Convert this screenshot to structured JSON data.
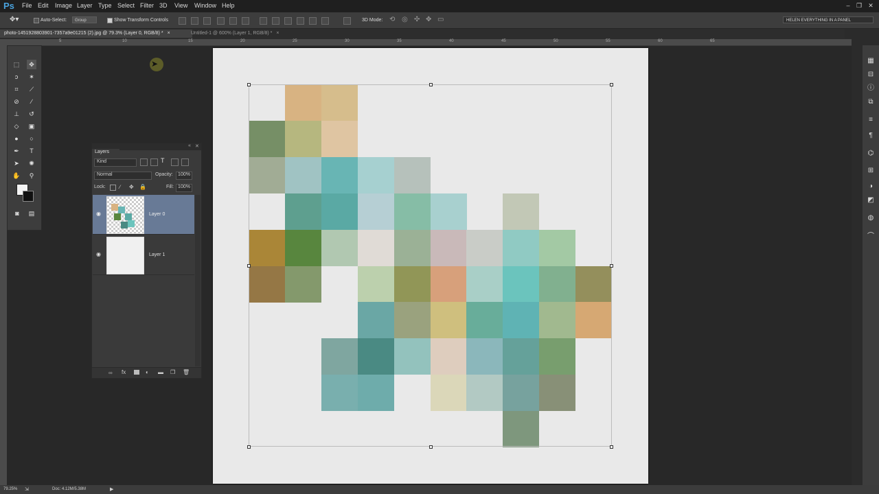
{
  "app": {
    "logo": "Ps"
  },
  "menu": [
    "File",
    "Edit",
    "Image",
    "Layer",
    "Type",
    "Select",
    "Filter",
    "3D",
    "View",
    "Window",
    "Help"
  ],
  "window_controls": {
    "minimize": "–",
    "restore": "❐",
    "close": "✕"
  },
  "options_bar": {
    "tool_icon": "move-tool-icon",
    "auto_select_label": "Auto-Select:",
    "auto_select_value": "Group",
    "transform_controls_label": "Show Transform Controls",
    "mode_3d_label": "3D Mode:",
    "workspace": "HELEN EVERYTHING IN A PANEL"
  },
  "tabs": [
    {
      "label": "photo-1451928803901-7357a9e01215 (2).jpg @ 79.3% (Layer 0, RGB/8) *",
      "close": "×",
      "active": true
    },
    {
      "label": "Untitled-1 @ 600% (Layer 1, RGB/8) *",
      "close": "×",
      "active": false
    }
  ],
  "ruler_labels": [
    "5",
    "10",
    "15",
    "20",
    "25",
    "30",
    "35",
    "40",
    "45",
    "50",
    "55",
    "60",
    "65"
  ],
  "layers_panel": {
    "title": "Layers",
    "filter_kind": "Kind",
    "blend_mode": "Normal",
    "opacity_label": "Opacity:",
    "opacity_value": "100%",
    "lock_label": "Lock:",
    "fill_label": "Fill:",
    "fill_value": "100%",
    "layers": [
      {
        "name": "Layer 0",
        "selected": true
      },
      {
        "name": "Layer 1",
        "selected": false
      }
    ]
  },
  "status_bar": {
    "zoom": "79.25%",
    "doc": "Doc: 4.12M/5.38M"
  },
  "colors": {
    "accent": "#4aa3df",
    "selected_layer": "#687a96"
  },
  "mosaic": {
    "cols": 10,
    "rows": 10,
    "tiles": [
      {
        "c": 1,
        "r": 0,
        "color": "#d8b382"
      },
      {
        "c": 2,
        "r": 0,
        "color": "#d6bd8c"
      },
      {
        "c": 0,
        "r": 1,
        "color": "#768f66"
      },
      {
        "c": 1,
        "r": 1,
        "color": "#b6b77f"
      },
      {
        "c": 2,
        "r": 1,
        "color": "#dfc5a2"
      },
      {
        "c": 0,
        "r": 2,
        "color": "#a1ac95"
      },
      {
        "c": 1,
        "r": 2,
        "color": "#a0c3c3"
      },
      {
        "c": 2,
        "r": 2,
        "color": "#68b5b4"
      },
      {
        "c": 3,
        "r": 2,
        "color": "#a6d0d0"
      },
      {
        "c": 4,
        "r": 2,
        "color": "#b6c1bb"
      },
      {
        "c": 1,
        "r": 3,
        "color": "#5e9f8f"
      },
      {
        "c": 2,
        "r": 3,
        "color": "#5aa9a4"
      },
      {
        "c": 3,
        "r": 3,
        "color": "#b6cfd4"
      },
      {
        "c": 4,
        "r": 3,
        "color": "#86bda6"
      },
      {
        "c": 5,
        "r": 3,
        "color": "#a8d0cf"
      },
      {
        "c": 7,
        "r": 3,
        "color": "#c2c8b6"
      },
      {
        "c": 0,
        "r": 4,
        "color": "#aa8637"
      },
      {
        "c": 1,
        "r": 4,
        "color": "#58863e"
      },
      {
        "c": 2,
        "r": 4,
        "color": "#b1c8b1"
      },
      {
        "c": 3,
        "r": 4,
        "color": "#e0dbd6"
      },
      {
        "c": 4,
        "r": 4,
        "color": "#9bb196"
      },
      {
        "c": 5,
        "r": 4,
        "color": "#c9b9b9"
      },
      {
        "c": 6,
        "r": 4,
        "color": "#c9ccc7"
      },
      {
        "c": 7,
        "r": 4,
        "color": "#90cac3"
      },
      {
        "c": 8,
        "r": 4,
        "color": "#a3c9a4"
      },
      {
        "c": 0,
        "r": 5,
        "color": "#957745"
      },
      {
        "c": 1,
        "r": 5,
        "color": "#84996c"
      },
      {
        "c": 3,
        "r": 5,
        "color": "#bcd0ad"
      },
      {
        "c": 4,
        "r": 5,
        "color": "#919657"
      },
      {
        "c": 5,
        "r": 5,
        "color": "#d7a07b"
      },
      {
        "c": 6,
        "r": 5,
        "color": "#a9cfc7"
      },
      {
        "c": 7,
        "r": 5,
        "color": "#6bc4bd"
      },
      {
        "c": 8,
        "r": 5,
        "color": "#81b08f"
      },
      {
        "c": 9,
        "r": 5,
        "color": "#948f5c"
      },
      {
        "c": 3,
        "r": 6,
        "color": "#6aa7a5"
      },
      {
        "c": 4,
        "r": 6,
        "color": "#9aa27e"
      },
      {
        "c": 5,
        "r": 6,
        "color": "#cfbf7e"
      },
      {
        "c": 6,
        "r": 6,
        "color": "#68ad9a"
      },
      {
        "c": 7,
        "r": 6,
        "color": "#5fb3b4"
      },
      {
        "c": 8,
        "r": 6,
        "color": "#a1b98f"
      },
      {
        "c": 9,
        "r": 6,
        "color": "#d6a873"
      },
      {
        "c": 2,
        "r": 7,
        "color": "#7fa6a0"
      },
      {
        "c": 3,
        "r": 7,
        "color": "#4a8a83"
      },
      {
        "c": 4,
        "r": 7,
        "color": "#93c2bd"
      },
      {
        "c": 5,
        "r": 7,
        "color": "#decdbe"
      },
      {
        "c": 6,
        "r": 7,
        "color": "#8bb7bb"
      },
      {
        "c": 7,
        "r": 7,
        "color": "#65a19a"
      },
      {
        "c": 8,
        "r": 7,
        "color": "#789e6e"
      },
      {
        "c": 2,
        "r": 8,
        "color": "#79afae"
      },
      {
        "c": 3,
        "r": 8,
        "color": "#6eacab"
      },
      {
        "c": 5,
        "r": 8,
        "color": "#dbd7b9"
      },
      {
        "c": 6,
        "r": 8,
        "color": "#b2c9c3"
      },
      {
        "c": 7,
        "r": 8,
        "color": "#77a29e"
      },
      {
        "c": 8,
        "r": 8,
        "color": "#889077"
      },
      {
        "c": 7,
        "r": 9,
        "color": "#7e977d"
      }
    ]
  }
}
